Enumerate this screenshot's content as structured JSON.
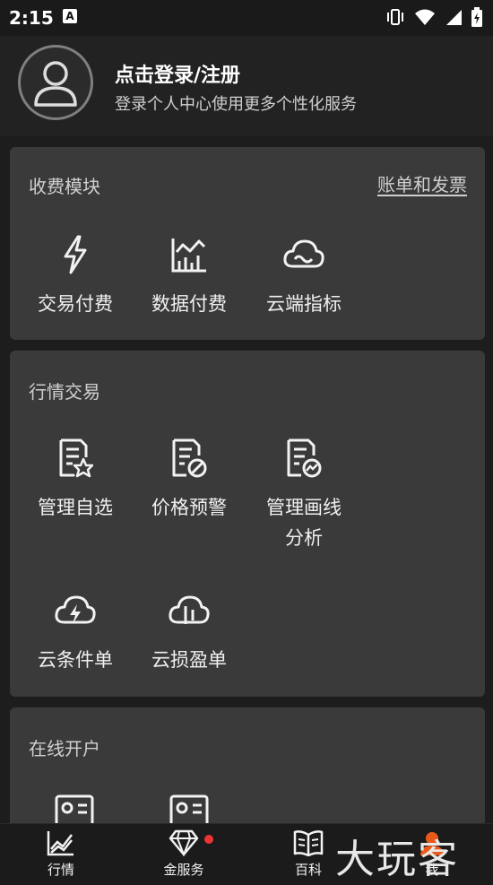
{
  "status": {
    "time": "2:15",
    "badge": "A"
  },
  "header": {
    "title": "点击登录/注册",
    "subtitle": "登录个人中心使用更多个性化服务"
  },
  "fees": {
    "title": "收费模块",
    "link": "账单和发票",
    "items": [
      {
        "label": "交易付费",
        "icon": "lightning-icon"
      },
      {
        "label": "数据付费",
        "icon": "chart-icon"
      },
      {
        "label": "云端指标",
        "icon": "cloud-icon"
      }
    ]
  },
  "market": {
    "title": "行情交易",
    "items": [
      {
        "label": "管理自选",
        "icon": "doc-star-icon"
      },
      {
        "label": "价格预警",
        "icon": "doc-alert-icon"
      },
      {
        "label": "管理画线",
        "label2": "分析",
        "icon": "doc-chart-icon"
      },
      {
        "label": "云条件单",
        "icon": "cloud-bolt-icon"
      },
      {
        "label": "云损盈单",
        "icon": "cloud-chart-icon"
      }
    ]
  },
  "online": {
    "title": "在线开户"
  },
  "nav": {
    "items": [
      {
        "label": "行情",
        "icon": "market-chart-icon"
      },
      {
        "label": "金服务",
        "icon": "diamond-icon"
      },
      {
        "label": "百科",
        "icon": "book-icon"
      },
      {
        "label": "我",
        "icon": "user-icon"
      }
    ]
  },
  "watermark": "大玩客"
}
